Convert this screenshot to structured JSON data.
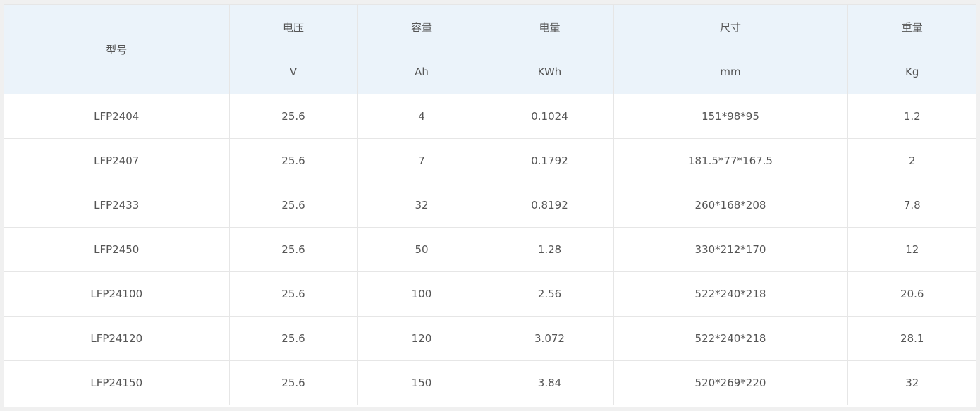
{
  "table": {
    "header": {
      "model": "型号",
      "columns": [
        {
          "name": "电压",
          "unit": "V"
        },
        {
          "name": "容量",
          "unit": "Ah"
        },
        {
          "name": "电量",
          "unit": "KWh"
        },
        {
          "name": "尺寸",
          "unit": "mm"
        },
        {
          "name": "重量",
          "unit": "Kg"
        }
      ]
    },
    "rows": [
      [
        "LFP2404",
        "25.6",
        "4",
        "0.1024",
        "151*98*95",
        "1.2"
      ],
      [
        "LFP2407",
        "25.6",
        "7",
        "0.1792",
        "181.5*77*167.5",
        "2"
      ],
      [
        "LFP2433",
        "25.6",
        "32",
        "0.8192",
        "260*168*208",
        "7.8"
      ],
      [
        "LFP2450",
        "25.6",
        "50",
        "1.28",
        "330*212*170",
        "12"
      ],
      [
        "LFP24100",
        "25.6",
        "100",
        "2.56",
        "522*240*218",
        "20.6"
      ],
      [
        "LFP24120",
        "25.6",
        "120",
        "3.072",
        "522*240*218",
        "28.1"
      ],
      [
        "LFP24150",
        "25.6",
        "150",
        "3.84",
        "520*269*220",
        "32"
      ]
    ]
  }
}
